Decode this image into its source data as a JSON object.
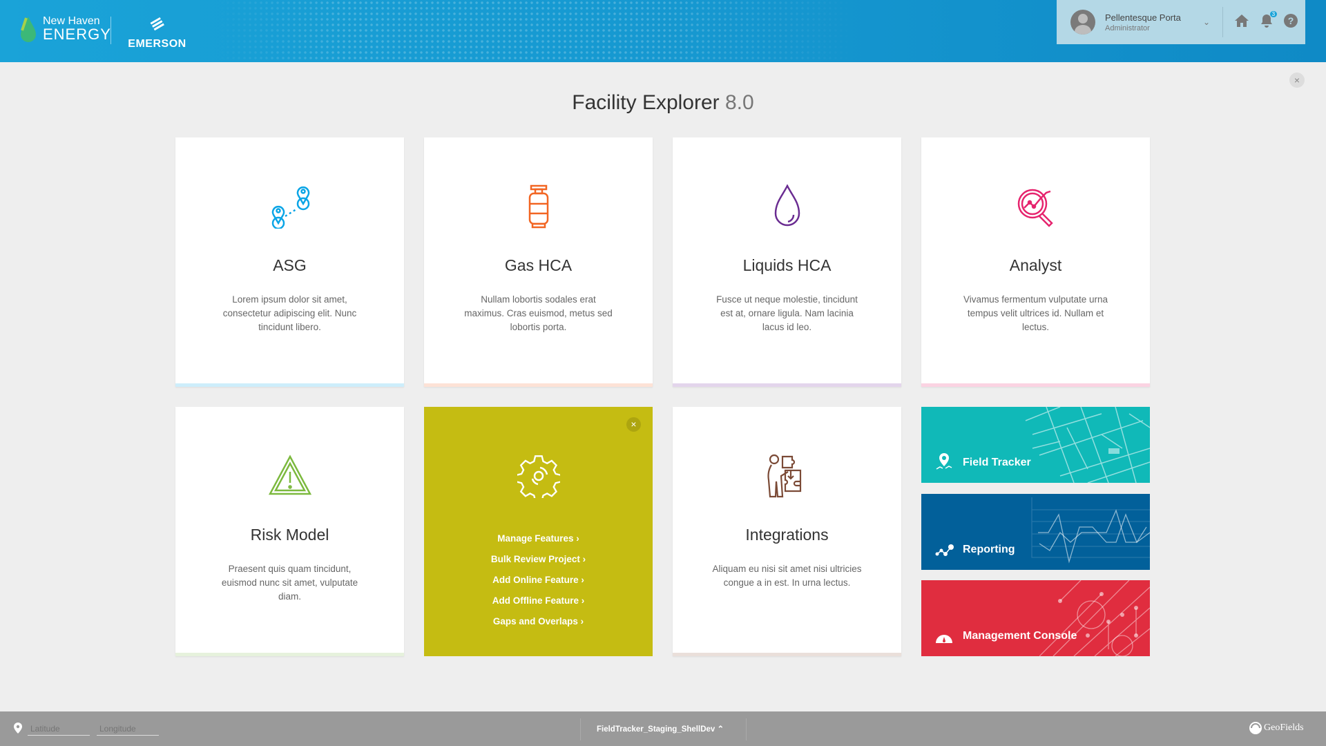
{
  "header": {
    "brand1_line1": "New Haven",
    "brand1_line2": "ENERGY",
    "brand2": "EMERSON",
    "user": {
      "name": "Pellentesque Porta",
      "role": "Administrator"
    },
    "notifications_count": "3"
  },
  "page": {
    "title": "Facility Explorer",
    "version": "8.0"
  },
  "cards": [
    {
      "title": "ASG",
      "description": "Lorem ipsum dolor sit amet, consectetur adipiscing elit. Nunc tincidunt libero.",
      "icon": "map-pins-icon",
      "color": "#0aa5e6"
    },
    {
      "title": "Gas HCA",
      "description": "Nullam lobortis sodales erat maximus. Cras euismod, metus sed lobortis porta.",
      "icon": "gas-cylinder-icon",
      "color": "#f26522"
    },
    {
      "title": "Liquids HCA",
      "description": "Fusce ut neque molestie, tincidunt est at, ornare ligula. Nam lacinia lacus id leo.",
      "icon": "droplet-icon",
      "color": "#6a2c91"
    },
    {
      "title": "Analyst",
      "description": "Vivamus fermentum vulputate urna tempus velit ultrices id. Nullam et lectus.",
      "icon": "magnifier-chart-icon",
      "color": "#e6246e"
    },
    {
      "title": "Risk Model",
      "description": "Praesent quis quam tincidunt, euismod nunc sit amet, vulputate diam.",
      "icon": "warning-icon",
      "color": "#7cb93e"
    },
    {
      "title": "Integrations",
      "description": "Aliquam eu nisi sit amet nisi ultricies congue a in est. In urna lectus.",
      "icon": "puzzle-person-icon",
      "color": "#7b4a36"
    }
  ],
  "feature_menu": {
    "color": "#c5bc12",
    "icon": "gear-icon",
    "items": [
      "Manage Features",
      "Bulk Review Project",
      "Add Online Feature",
      "Add Offline Feature",
      "Gaps and Overlaps"
    ]
  },
  "tiles": [
    {
      "label": "Field Tracker",
      "color": "#10b9b8",
      "icon": "location-pin-icon"
    },
    {
      "label": "Reporting",
      "color": "#02609a",
      "icon": "line-graph-icon"
    },
    {
      "label": "Management Console",
      "color": "#e02d3f",
      "icon": "dashboard-gauge-icon"
    }
  ],
  "footer": {
    "latitude_placeholder": "Latitude",
    "longitude_placeholder": "Longitude",
    "environment": "FieldTracker_Staging_ShellDev",
    "brand": "GeoFields"
  }
}
